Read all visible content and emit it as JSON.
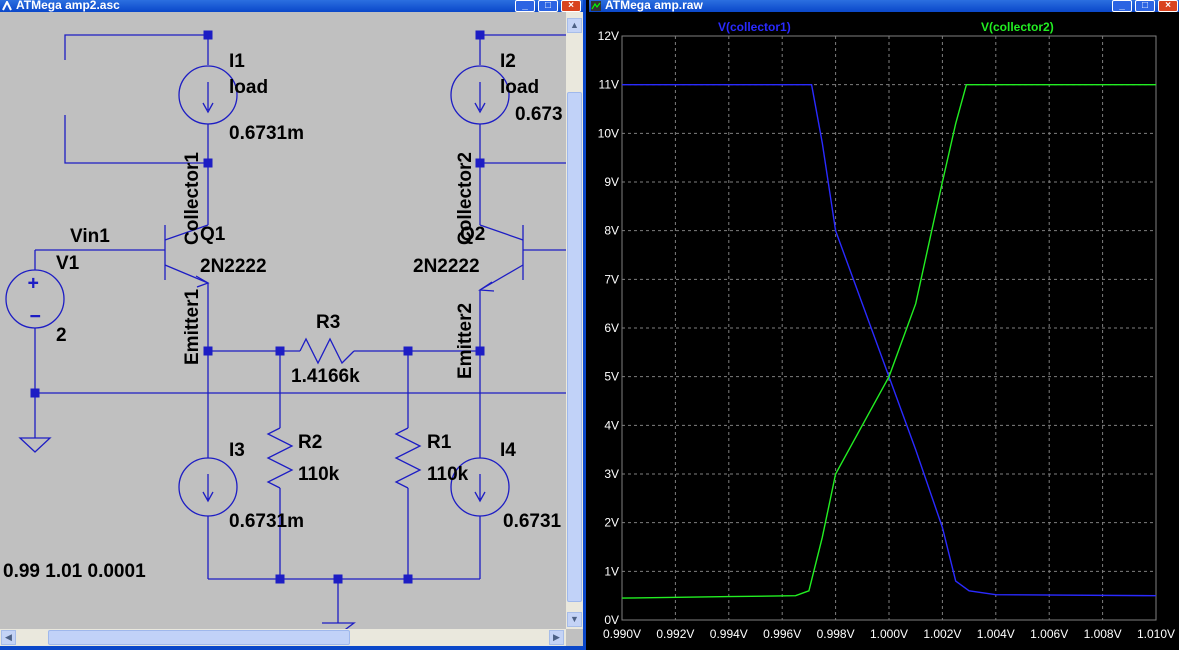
{
  "left_window": {
    "title": "ATMega amp2.asc",
    "schematic": {
      "I1": {
        "name": "I1",
        "value_label": "load",
        "current": "0.6731m"
      },
      "I2": {
        "name": "I2",
        "value_label": "load",
        "current": "0.673"
      },
      "I3": {
        "name": "I3",
        "current": "0.6731m"
      },
      "I4": {
        "name": "I4",
        "current": "0.6731"
      },
      "Q1": {
        "name": "Q1",
        "model": "2N2222"
      },
      "Q2": {
        "name": "Q2",
        "model": "2N2222"
      },
      "V1": {
        "name": "V1",
        "value": "2",
        "net": "Vin1"
      },
      "R1": {
        "name": "R1",
        "value": "110k"
      },
      "R2": {
        "name": "R2",
        "value": "110k"
      },
      "R3": {
        "name": "R3",
        "value": "1.4166k"
      },
      "nets": {
        "collector1": "Collector1",
        "collector2": "Collector2",
        "emitter1": "Emitter1",
        "emitter2": "Emitter2"
      },
      "directive": "0.99 1.01 0.0001"
    }
  },
  "right_window": {
    "title": "ATMega amp.raw",
    "colors": {
      "background": "#000000",
      "grid": "#7f7f7f",
      "axis_text": "#ffffff",
      "series1": "#2a2aff",
      "series2": "#22ee22"
    }
  },
  "chart_data": {
    "type": "line",
    "xlabel": "",
    "ylabel": "",
    "xlim": [
      0.99,
      1.01
    ],
    "ylim": [
      0,
      12
    ],
    "x_ticks": [
      "0.990V",
      "0.992V",
      "0.994V",
      "0.996V",
      "0.998V",
      "1.000V",
      "1.002V",
      "1.004V",
      "1.006V",
      "1.008V",
      "1.010V"
    ],
    "y_ticks": [
      "0V",
      "1V",
      "2V",
      "3V",
      "4V",
      "5V",
      "6V",
      "7V",
      "8V",
      "9V",
      "10V",
      "11V",
      "12V"
    ],
    "grid": true,
    "series": [
      {
        "name": "V(collector1)",
        "color": "#2a2aff",
        "points": [
          [
            0.99,
            11.0
          ],
          [
            0.9965,
            11.0
          ],
          [
            0.9971,
            11.0
          ],
          [
            0.9975,
            9.8
          ],
          [
            0.998,
            8.0
          ],
          [
            0.999,
            6.5
          ],
          [
            1.0,
            5.0
          ],
          [
            1.001,
            3.5
          ],
          [
            1.002,
            1.9
          ],
          [
            1.0025,
            0.8
          ],
          [
            1.003,
            0.6
          ],
          [
            1.004,
            0.52
          ],
          [
            1.01,
            0.5
          ]
        ]
      },
      {
        "name": "V(collector2)",
        "color": "#22ee22",
        "points": [
          [
            0.99,
            0.45
          ],
          [
            0.994,
            0.48
          ],
          [
            0.9965,
            0.5
          ],
          [
            0.997,
            0.6
          ],
          [
            0.9975,
            1.7
          ],
          [
            0.998,
            3.0
          ],
          [
            0.999,
            4.0
          ],
          [
            1.0,
            5.0
          ],
          [
            1.001,
            6.5
          ],
          [
            1.002,
            9.0
          ],
          [
            1.0025,
            10.2
          ],
          [
            1.0029,
            11.0
          ],
          [
            1.004,
            11.0
          ],
          [
            1.01,
            11.0
          ]
        ]
      }
    ]
  }
}
